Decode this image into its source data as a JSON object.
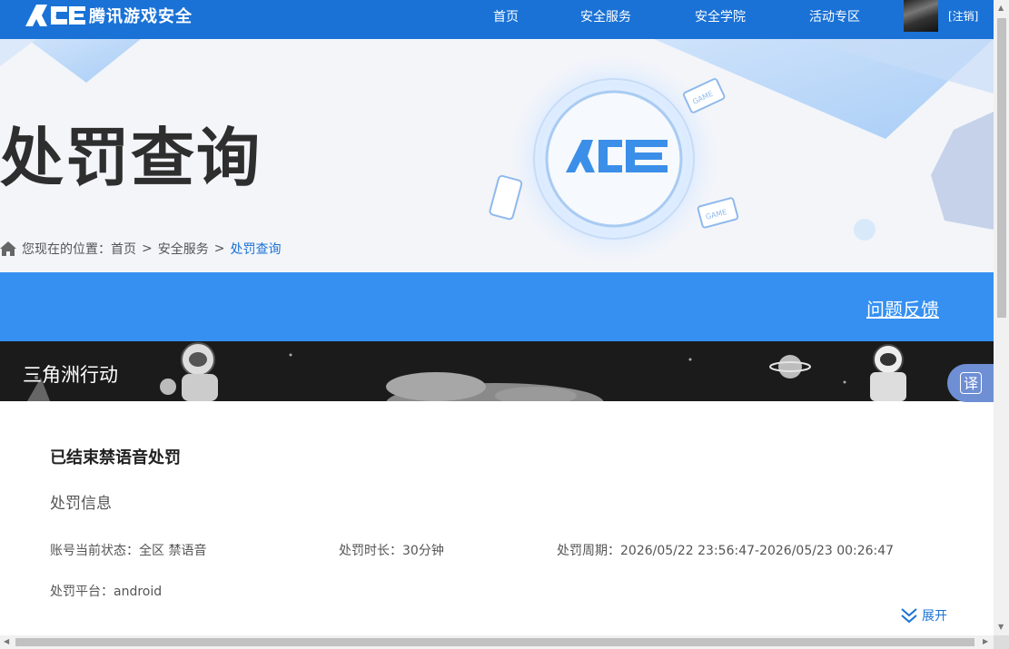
{
  "brand": {
    "name": "腾讯游戏安全",
    "logo_text": "ACE"
  },
  "nav": {
    "items": [
      "首页",
      "安全服务",
      "安全学院",
      "活动专区"
    ],
    "logout": "[注销]"
  },
  "hero": {
    "title": "处罚查询",
    "breadcrumb": {
      "prefix": "您现在的位置：",
      "items": [
        "首页",
        "安全服务",
        "处罚查询"
      ],
      "separator": ">"
    },
    "badge_text": "GAME"
  },
  "feedback": {
    "label": "问题反馈"
  },
  "game": {
    "name": "三角洲行动"
  },
  "punishment": {
    "status_title": "已结束禁语音处罚",
    "section_title": "处罚信息",
    "account_status": "账号当前状态：全区 禁语音",
    "duration": "处罚时长：30分钟",
    "period": "处罚周期：2026/05/22 23:56:47-2026/05/23 00:26:47",
    "platform": "处罚平台：android",
    "expand_label": "展开"
  },
  "translate": {
    "label": "译"
  },
  "colors": {
    "nav_blue": "#1a72d6",
    "feedback_blue": "#3590f2",
    "accent": "#1a72d6"
  }
}
